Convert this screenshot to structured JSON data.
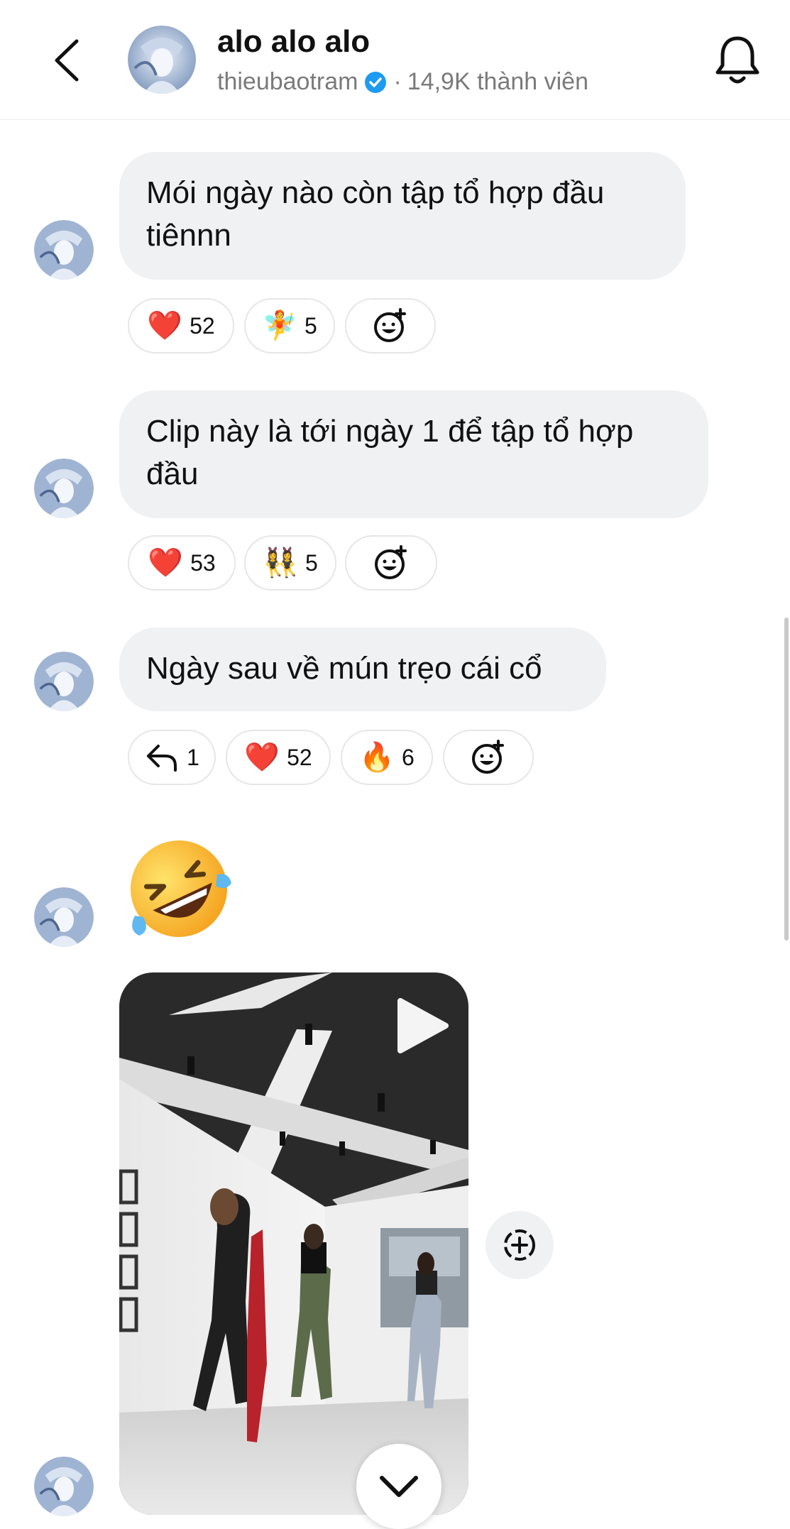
{
  "header": {
    "title": "alo alo alo",
    "username": "thieubaotram",
    "separator": "·",
    "members": "14,9K thành viên"
  },
  "messages": [
    {
      "text": "Mói ngày nào còn tập tổ hợp đầu tiênnn",
      "reactions": [
        {
          "emoji": "❤️",
          "count": "52"
        },
        {
          "emoji": "🧚",
          "count": "5"
        }
      ]
    },
    {
      "text": "Clip này là tới ngày 1 để tập tổ hợp đầu",
      "reactions": [
        {
          "emoji": "❤️",
          "count": "53"
        },
        {
          "emoji": "👯‍♀️",
          "count": "5"
        }
      ]
    },
    {
      "text": "Ngày sau về mún trẹo cái cổ",
      "reply_count": "1",
      "reactions": [
        {
          "emoji": "❤️",
          "count": "52"
        },
        {
          "emoji": "🔥",
          "count": "6"
        }
      ]
    }
  ],
  "icons": {
    "back": "chevron-left-icon",
    "bell": "bell-icon",
    "verified": "verified-badge-icon",
    "add_reaction": "add-reaction-icon",
    "reply": "reply-icon",
    "play": "play-icon",
    "share": "share-icon",
    "scroll_down": "chevron-down-icon"
  },
  "colors": {
    "bubble": "#f0f1f3",
    "verified": "#1d9bf0",
    "heart": "#e8252e"
  }
}
